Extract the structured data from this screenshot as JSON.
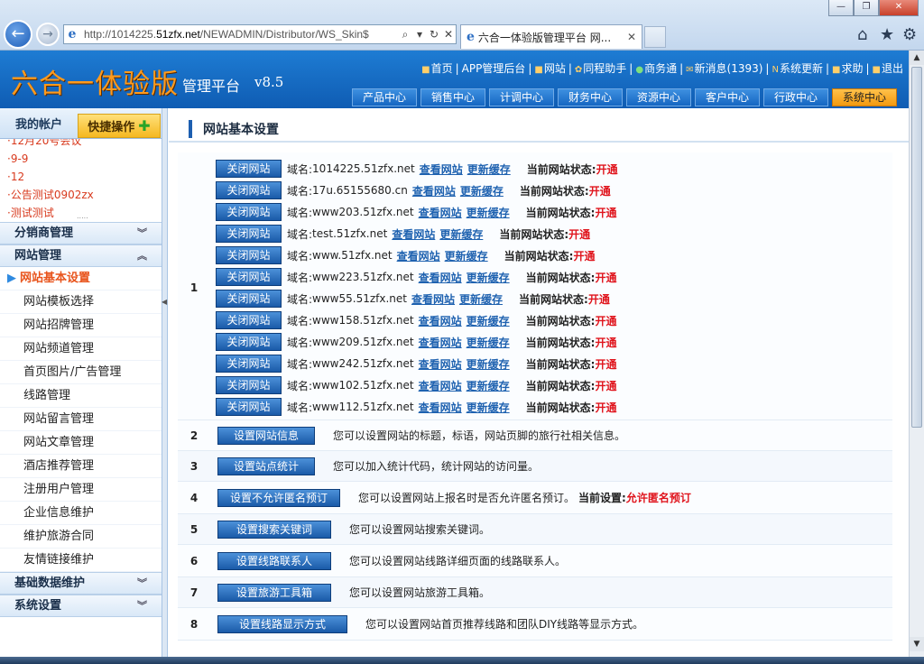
{
  "browser": {
    "url_prefix": "http://1014225.",
    "url_domain": "51zfx.net",
    "url_rest": "/NEWADMIN/Distributor/WS_Skin$",
    "tab_title": "六合一体验版管理平台 网...",
    "icons": [
      "back-arrow",
      "forward-arrow",
      "search-icon",
      "refresh-icon",
      "home-icon",
      "favorites-star-icon",
      "settings-gear-icon"
    ]
  },
  "header": {
    "brand": "六合一体验版",
    "sub": "管理平台",
    "version": "v8.5",
    "top_links": [
      "首页",
      "APP管理后台",
      "网站",
      "同程助手",
      "商务通",
      "新消息(1393)",
      "系统更新",
      "求助",
      "退出"
    ],
    "tabs": [
      "产品中心",
      "销售中心",
      "计调中心",
      "财务中心",
      "资源中心",
      "客户中心",
      "行政中心",
      "系统中心"
    ],
    "active_tab": "系统中心"
  },
  "sidebar": {
    "account_label": "我的帐户",
    "quick_label": "快捷操作",
    "notices": [
      "·12月20号会议",
      "·9-9",
      "·12",
      "·公告测试0902zx",
      "·测试测试"
    ],
    "groups": {
      "distribution": "分销商管理",
      "website": "网站管理",
      "basic_data": "基础数据维护",
      "system": "系统设置"
    },
    "website_items": [
      "网站基本设置",
      "网站模板选择",
      "网站招牌管理",
      "网站频道管理",
      "首页图片/广告管理",
      "线路管理",
      "网站留言管理",
      "网站文章管理",
      "酒店推荐管理",
      "注册用户管理",
      "企业信息维护",
      "维护旅游合同",
      "友情链接维护"
    ]
  },
  "content": {
    "title": "网站基本设置",
    "row1": {
      "num": "1",
      "close_btn": "关闭网站",
      "domain_label": "域名:",
      "view_link": "查看网站",
      "refresh_link": "更新缓存",
      "status_label": "当前网站状态:",
      "status_value": "开通",
      "domains": [
        "1014225.51zfx.net",
        "17u.65155680.cn",
        "www203.51zfx.net",
        "test.51zfx.net",
        "www.51zfx.net",
        "www223.51zfx.net",
        "www55.51zfx.net",
        "www158.51zfx.net",
        "www209.51zfx.net",
        "www242.51zfx.net",
        "www102.51zfx.net",
        "www112.51zfx.net"
      ]
    },
    "rows": [
      {
        "num": "2",
        "button": "设置网站信息",
        "desc": "您可以设置网站的标题，标语，网站页脚的旅行社相关信息。"
      },
      {
        "num": "3",
        "button": "设置站点统计",
        "desc": "您可以加入统计代码，统计网站的访问量。"
      },
      {
        "num": "4",
        "button": "设置不允许匿名预订",
        "desc": "您可以设置网站上报名时是否允许匿名预订。",
        "setting_label": "当前设置:",
        "setting_value": "允许匿名预订"
      },
      {
        "num": "5",
        "button": "设置搜索关键词",
        "desc": "您可以设置网站搜索关键词。"
      },
      {
        "num": "6",
        "button": "设置线路联系人",
        "desc": "您可以设置网站线路详细页面的线路联系人。"
      },
      {
        "num": "7",
        "button": "设置旅游工具箱",
        "desc": "您可以设置网站旅游工具箱。"
      },
      {
        "num": "8",
        "button": "设置线路显示方式",
        "desc": "您可以设置网站首页推荐线路和团队DIY线路等显示方式。"
      }
    ]
  }
}
